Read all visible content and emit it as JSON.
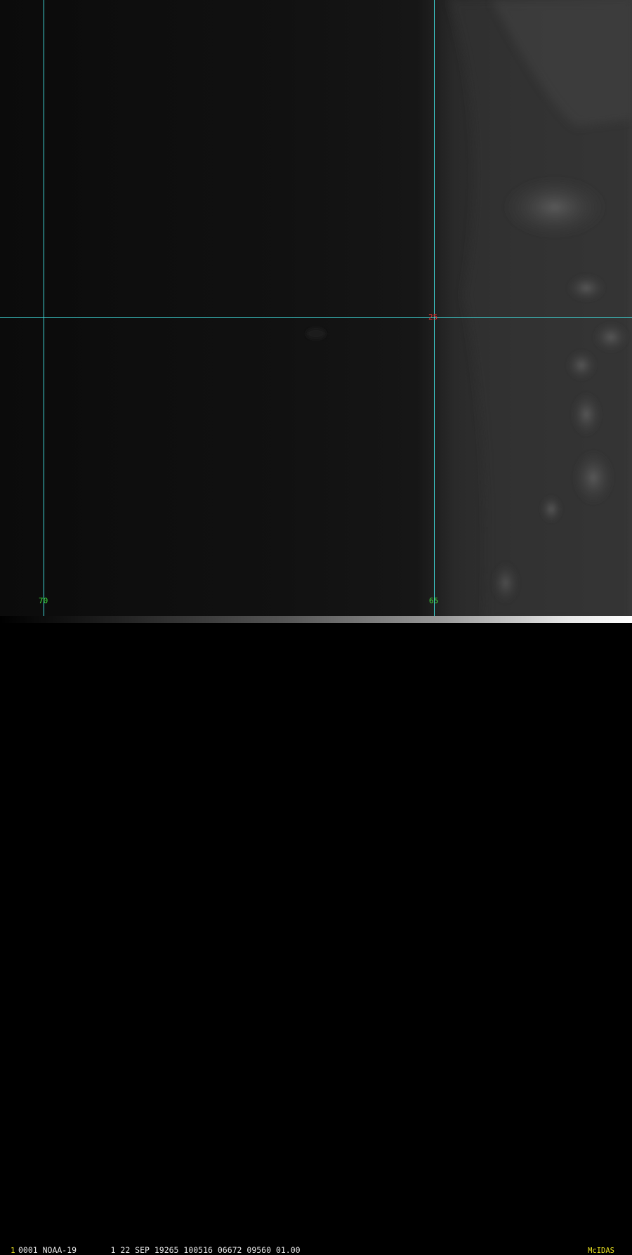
{
  "imagery": {
    "grid": {
      "longitudes": [
        "70",
        "65"
      ],
      "latitudes": [
        "25"
      ]
    }
  },
  "status_bar": {
    "frame_number": "1",
    "info_text": "0001 NOAA-19       1 22 SEP 19265 100516 06672 09560 01.00",
    "brand": "McIDAS"
  },
  "colors": {
    "gridline": "#3fd8d8",
    "lon_label": "#3ee03e",
    "lat_label": "#e03030",
    "brand": "#e8e020"
  }
}
